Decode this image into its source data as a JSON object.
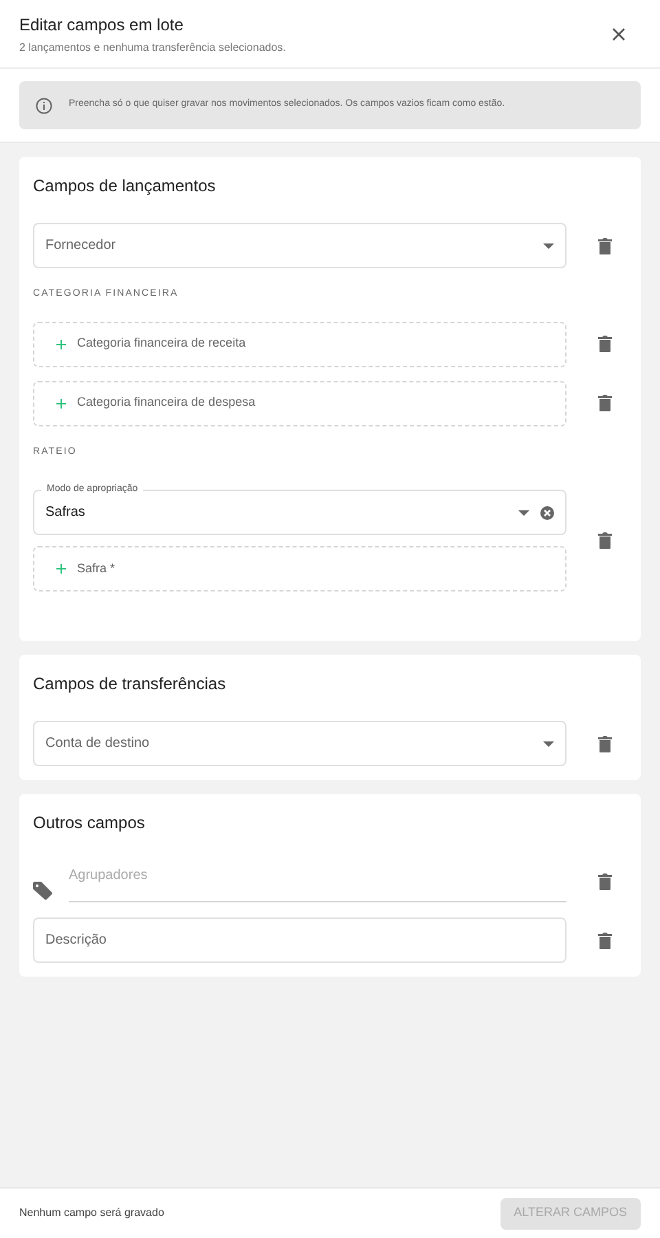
{
  "header": {
    "title": "Editar campos em lote",
    "subtitle": "2 lançamentos e nenhuma transferência selecionados."
  },
  "info": "Preencha só o que quiser gravar nos movimentos selecionados. Os campos vazios ficam como estão.",
  "sections": [
    {
      "title": "Campos de lançamentos",
      "rows": [
        {
          "kind": "select",
          "placeholder": "Fornecedor"
        },
        {
          "kind": "label",
          "text": "CATEGORIA FINANCEIRA"
        },
        {
          "kind": "add",
          "text": "Categoria financeira de receita"
        },
        {
          "kind": "add",
          "text": "Categoria financeira de despesa"
        },
        {
          "kind": "label",
          "text": "RATEIO"
        },
        {
          "kind": "group",
          "items": [
            {
              "kind": "filled_select",
              "label": "Modo de apropriação",
              "value": "Safras"
            },
            {
              "kind": "add",
              "text": "Safra *"
            }
          ]
        }
      ]
    },
    {
      "title": "Campos de transferências",
      "rows": [
        {
          "kind": "select",
          "placeholder": "Conta de destino"
        }
      ]
    },
    {
      "title": "Outros campos",
      "rows": [
        {
          "kind": "tags",
          "placeholder": "Agrupadores"
        },
        {
          "kind": "text",
          "placeholder": "Descrição"
        }
      ]
    }
  ],
  "footer": {
    "status": "Nenhum campo será gravado",
    "button": {
      "label": "ALTERAR CAMPOS",
      "disabled": true
    }
  }
}
